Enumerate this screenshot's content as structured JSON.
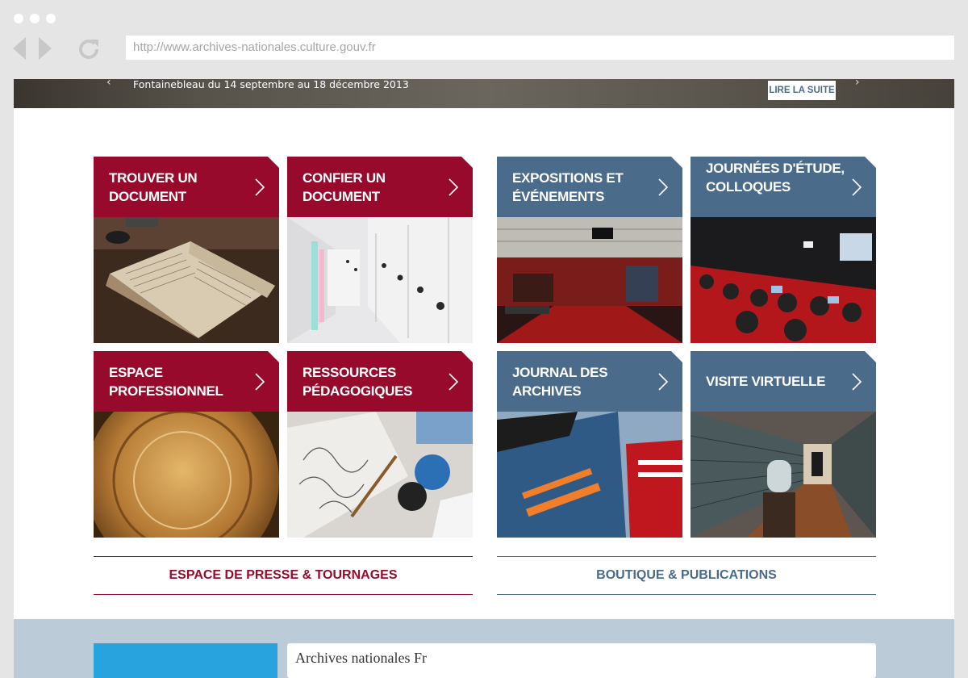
{
  "browser": {
    "url": "http://www.archives-nationales.culture.gouv.fr"
  },
  "banner": {
    "text": "Fontainebleau du 14 septembre au 18 décembre 2013",
    "button_label": "LIRE LA SUITE",
    "prev_glyph": "‹",
    "next_glyph": "›"
  },
  "tiles": [
    {
      "label": "TROUVER UN DOCUMENT",
      "color": "red",
      "icon": "chevron-right-icon"
    },
    {
      "label": "CONFIER UN DOCUMENT",
      "color": "red",
      "icon": "chevron-right-icon"
    },
    {
      "label": "EXPOSITIONS ET ÉVÉNEMENTS",
      "color": "blue",
      "icon": "chevron-right-icon"
    },
    {
      "label": "JOURNÉES D'ÉTUDE, COLLOQUES",
      "color": "blue",
      "icon": "chevron-right-icon"
    },
    {
      "label": "ESPACE PROFESSIONNEL",
      "color": "red",
      "icon": "chevron-right-icon"
    },
    {
      "label": "RESSOURCES PÉDAGOGIQUES",
      "color": "red",
      "icon": "chevron-right-icon"
    },
    {
      "label": "JOURNAL DES ARCHIVES",
      "color": "blue",
      "icon": "chevron-right-icon"
    },
    {
      "label": "VISITE VIRTUELLE",
      "color": "blue",
      "icon": "chevron-right-icon"
    }
  ],
  "links": {
    "press": "ESPACE DE PRESSE & TOURNAGES",
    "shop": "BOUTIQUE & PUBLICATIONS"
  },
  "footer": {
    "partial_text": "Archives nationales Fr"
  },
  "colors": {
    "red": "#980a2b",
    "blue": "#4a6b8a",
    "footer_bg": "#bccbd8",
    "footer_accent": "#29a3dd"
  }
}
